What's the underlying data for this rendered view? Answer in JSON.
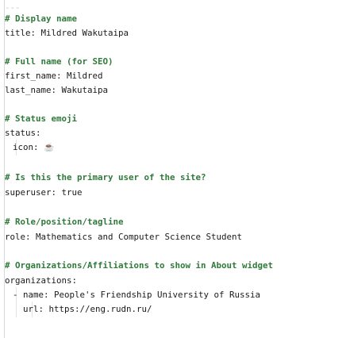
{
  "editor": {
    "lines": [
      {
        "kind": "sep",
        "text": "---"
      },
      {
        "kind": "comment",
        "text": "# Display name"
      },
      {
        "kind": "kv",
        "text": "title: Mildred Wakutaipa"
      },
      {
        "kind": "blank",
        "text": ""
      },
      {
        "kind": "comment",
        "text": "# Full name (for SEO)"
      },
      {
        "kind": "kv",
        "text": "first_name: Mildred"
      },
      {
        "kind": "kv",
        "text": "last_name: Wakutaipa"
      },
      {
        "kind": "blank",
        "text": ""
      },
      {
        "kind": "comment",
        "text": "# Status emoji"
      },
      {
        "kind": "kv",
        "text": "status:"
      },
      {
        "kind": "kv",
        "text": "  icon: ☕️"
      },
      {
        "kind": "blank",
        "text": ""
      },
      {
        "kind": "comment",
        "text": "# Is this the primary user of the site?"
      },
      {
        "kind": "kv",
        "text": "superuser: true"
      },
      {
        "kind": "blank",
        "text": ""
      },
      {
        "kind": "comment",
        "text": "# Role/position/tagline"
      },
      {
        "kind": "kv",
        "text": "role: Mathematics and Computer Science Student"
      },
      {
        "kind": "blank",
        "text": ""
      },
      {
        "kind": "comment",
        "text": "# Organizations/Affiliations to show in About widget"
      },
      {
        "kind": "kv",
        "text": "organizations:"
      },
      {
        "kind": "kv",
        "text": "  - name: People's Friendship University of Russia"
      },
      {
        "kind": "kv",
        "text": "    url: https://eng.rudn.ru/"
      }
    ]
  }
}
